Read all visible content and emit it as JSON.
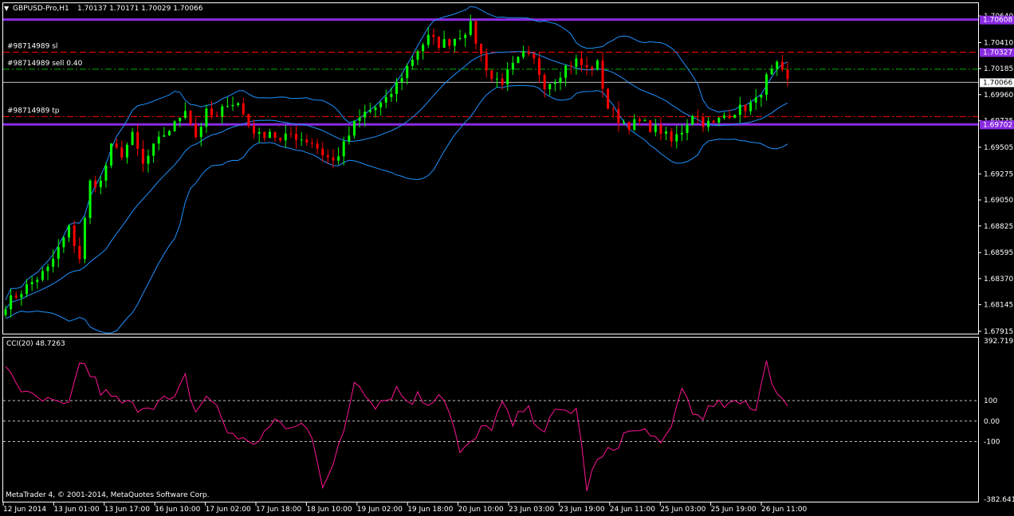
{
  "header": {
    "symbol_caption": "GBPUSD-Pro,H1",
    "ohlc_caption": "1.70137 1.70171 1.70029 1.70066"
  },
  "price_axis": {
    "labels": [
      "1.70640",
      "1.70410",
      "1.70185",
      "1.69960",
      "1.69735",
      "1.69505",
      "1.69275",
      "1.69050",
      "1.68825",
      "1.68595",
      "1.68370",
      "1.68145",
      "1.67915"
    ],
    "tags": {
      "resistance": "1.70608",
      "sl": "1.70327",
      "current": "1.70066",
      "support": "1.69702"
    }
  },
  "levels": [
    {
      "id": "resistance",
      "price": 1.70608,
      "color": "#8a2be2",
      "style": "solid",
      "label": ""
    },
    {
      "id": "sl",
      "price": 1.70327,
      "color": "#ff0000",
      "style": "dash",
      "label": "#98714989 sl"
    },
    {
      "id": "sell",
      "price": 1.7018,
      "color": "#00b000",
      "style": "dashdot",
      "label": "#98714989 sell 0.40"
    },
    {
      "id": "current",
      "price": 1.70066,
      "color": "#c0c0c0",
      "style": "solid",
      "label": ""
    },
    {
      "id": "tp",
      "price": 1.6977,
      "color": "#ff0000",
      "style": "dashdot",
      "label": "#98714989 tp"
    },
    {
      "id": "support",
      "price": 1.69702,
      "color": "#8a2be2",
      "style": "solid",
      "label": ""
    }
  ],
  "time_axis": {
    "labels": [
      "12 Jun 2014",
      "13 Jun 01:00",
      "13 Jun 17:00",
      "16 Jun 10:00",
      "17 Jun 02:00",
      "17 Jun 18:00",
      "18 Jun 10:00",
      "19 Jun 02:00",
      "19 Jun 18:00",
      "20 Jun 10:00",
      "23 Jun 03:00",
      "23 Jun 19:00",
      "24 Jun 11:00",
      "25 Jun 03:00",
      "25 Jun 19:00",
      "26 Jun 11:00"
    ]
  },
  "cci": {
    "caption": "CCI(20) 48.7263",
    "axis_labels": [
      "392.719",
      "100",
      "0.00",
      "-100",
      "-382.6412"
    ],
    "levels": [
      100,
      0,
      -100
    ]
  },
  "footer": {
    "copyright": "MetaTrader 4, © 2001-2014, MetaQuotes Software Corp."
  },
  "colors": {
    "background": "#000000",
    "bull_candle": "#00ff00",
    "bear_candle": "#ff0000",
    "bollinger": "#1e90ff",
    "cci_line": "#ff1493",
    "axis_text": "#ffffff",
    "grid": "#c0c0c0"
  },
  "chart_data": [
    {
      "type": "candlestick",
      "symbol": "GBPUSD-Pro",
      "timeframe": "H1",
      "title": "GBPUSD-Pro,H1",
      "ylim": [
        1.67915,
        1.7064
      ],
      "close_path": [
        [
          0,
          1.6815
        ],
        [
          4,
          1.683
        ],
        [
          8,
          1.6845
        ],
        [
          12,
          1.688
        ],
        [
          14,
          1.6855
        ],
        [
          16,
          1.692
        ],
        [
          18,
          1.692
        ],
        [
          20,
          1.695
        ],
        [
          22,
          1.6945
        ],
        [
          24,
          1.696
        ],
        [
          26,
          1.6935
        ],
        [
          28,
          1.695
        ],
        [
          30,
          1.6962
        ],
        [
          32,
          1.697
        ],
        [
          34,
          1.6985
        ],
        [
          36,
          1.696
        ],
        [
          38,
          1.698
        ],
        [
          40,
          1.6975
        ],
        [
          42,
          1.699
        ],
        [
          44,
          1.6988
        ],
        [
          46,
          1.697
        ],
        [
          48,
          1.696
        ],
        [
          50,
          1.6965
        ],
        [
          52,
          1.6955
        ],
        [
          54,
          1.6962
        ],
        [
          56,
          1.6958
        ],
        [
          58,
          1.6955
        ],
        [
          60,
          1.6945
        ],
        [
          62,
          1.6938
        ],
        [
          64,
          1.6952
        ],
        [
          66,
          1.697
        ],
        [
          68,
          1.698
        ],
        [
          70,
          1.6985
        ],
        [
          72,
          1.699
        ],
        [
          74,
          1.7005
        ],
        [
          76,
          1.702
        ],
        [
          78,
          1.7035
        ],
        [
          80,
          1.7045
        ],
        [
          82,
          1.704
        ],
        [
          84,
          1.7042
        ],
        [
          86,
          1.7048
        ],
        [
          88,
          1.7055
        ],
        [
          90,
          1.703
        ],
        [
          92,
          1.701
        ],
        [
          94,
          1.7008
        ],
        [
          96,
          1.702
        ],
        [
          98,
          1.703
        ],
        [
          100,
          1.7025
        ],
        [
          102,
          1.7005
        ],
        [
          104,
          1.701
        ],
        [
          106,
          1.702
        ],
        [
          108,
          1.7025
        ],
        [
          110,
          1.7018
        ],
        [
          112,
          1.7022
        ],
        [
          114,
          1.6985
        ],
        [
          116,
          1.6975
        ],
        [
          118,
          1.697
        ],
        [
          120,
          1.6972
        ],
        [
          122,
          1.6968
        ],
        [
          124,
          1.6965
        ],
        [
          126,
          1.6955
        ],
        [
          128,
          1.6965
        ],
        [
          130,
          1.698
        ],
        [
          132,
          1.6972
        ],
        [
          134,
          1.697
        ],
        [
          136,
          1.6978
        ],
        [
          138,
          1.6982
        ],
        [
          140,
          1.6985
        ],
        [
          142,
          1.699
        ],
        [
          144,
          1.701
        ],
        [
          146,
          1.702
        ],
        [
          148,
          1.7007
        ]
      ]
    },
    {
      "type": "line",
      "title": "CCI(20) 48.7263",
      "ylim": [
        -382.6412,
        392.719
      ],
      "series": [
        {
          "name": "CCI(20)",
          "x": [
            0,
            4,
            8,
            12,
            14,
            16,
            18,
            20,
            22,
            24,
            26,
            28,
            30,
            32,
            34,
            36,
            38,
            40,
            42,
            44,
            46,
            48,
            50,
            52,
            54,
            56,
            58,
            60,
            62,
            64,
            66,
            68,
            70,
            72,
            74,
            76,
            78,
            80,
            82,
            84,
            86,
            88,
            90,
            92,
            94,
            96,
            98,
            100,
            102,
            104,
            106,
            108,
            110,
            112,
            114,
            116,
            118,
            120,
            122,
            124,
            126,
            128,
            130,
            132,
            134,
            136,
            138,
            140,
            142,
            144,
            146,
            148
          ],
          "values": [
            280,
            120,
            90,
            60,
            300,
            230,
            150,
            110,
            90,
            70,
            80,
            90,
            100,
            95,
            210,
            40,
            130,
            60,
            -50,
            -70,
            -120,
            -80,
            -30,
            -10,
            -40,
            -20,
            -60,
            -300,
            -220,
            -60,
            200,
            150,
            90,
            110,
            160,
            100,
            120,
            90,
            150,
            60,
            -160,
            -120,
            -50,
            -20,
            80,
            -30,
            60,
            20,
            -40,
            30,
            50,
            60,
            -320,
            -200,
            -160,
            -100,
            -50,
            -60,
            -40,
            -140,
            -40,
            180,
            30,
            40,
            60,
            80,
            70,
            90,
            70,
            300,
            130,
            50
          ]
        }
      ],
      "levels": [
        100,
        0,
        -100
      ]
    }
  ]
}
